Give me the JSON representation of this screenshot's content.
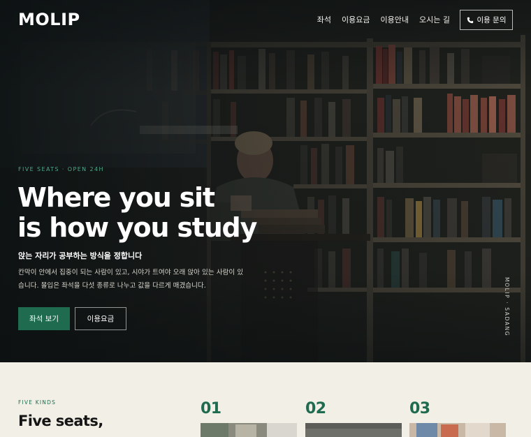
{
  "brand": {
    "logo": "MOLIP"
  },
  "nav": {
    "links": [
      "좌석",
      "이용요금",
      "이용안내",
      "오시는 길"
    ],
    "cta_label": "이용 문의",
    "cta_icon": "phone-icon"
  },
  "hero": {
    "eyebrow": "FIVE SEATS · OPEN 24H",
    "headline_line1": "Where you sit",
    "headline_line2": "is how you study",
    "subheading": "앉는 자리가 공부하는 방식을 정합니다",
    "description": "칸막이 안에서 집중이 되는 사람이 있고, 시야가 트여야 오래 앉아 있는 사람이 있습니다. 몰입은 좌석을 다섯 종류로 나누고 값을 다르게 매겼습니다.",
    "primary_button": "좌석 보기",
    "secondary_button": "이용요금",
    "vertical_label": "MOLIP · SADANG"
  },
  "seats_section": {
    "eyebrow": "FIVE KINDS",
    "title": "Five seats,",
    "cards": [
      {
        "number": "01"
      },
      {
        "number": "02"
      },
      {
        "number": "03"
      }
    ]
  },
  "colors": {
    "accent": "#1f6b50",
    "accent_light": "#4fa98a",
    "section_bg": "#f2efe6"
  }
}
